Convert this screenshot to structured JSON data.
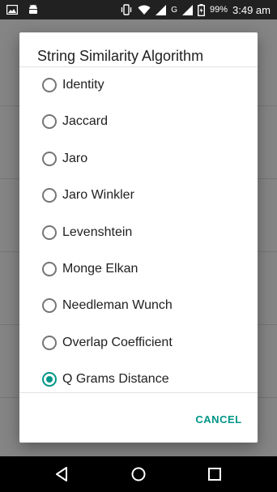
{
  "status_bar": {
    "battery_percent": "99%",
    "time": "3:49 am",
    "network_label": "G",
    "icons": [
      "image-icon",
      "android-icon",
      "vibrate-icon",
      "wifi-icon",
      "signal-icon",
      "signal-icon",
      "battery-charging-icon"
    ]
  },
  "dialog": {
    "title": "String Similarity Algorithm",
    "selected_index": 8,
    "options": [
      {
        "label": "Identity"
      },
      {
        "label": "Jaccard"
      },
      {
        "label": "Jaro"
      },
      {
        "label": "Jaro Winkler"
      },
      {
        "label": "Levenshtein"
      },
      {
        "label": "Monge Elkan"
      },
      {
        "label": "Needleman Wunch"
      },
      {
        "label": "Overlap Coefficient"
      },
      {
        "label": "Q Grams Distance"
      }
    ],
    "cancel_label": "CANCEL"
  },
  "nav_bar": {
    "buttons": [
      "back-icon",
      "home-icon",
      "recents-icon"
    ]
  },
  "colors": {
    "accent": "#009688",
    "status_bar": "#212121",
    "nav_bar": "#000000"
  }
}
